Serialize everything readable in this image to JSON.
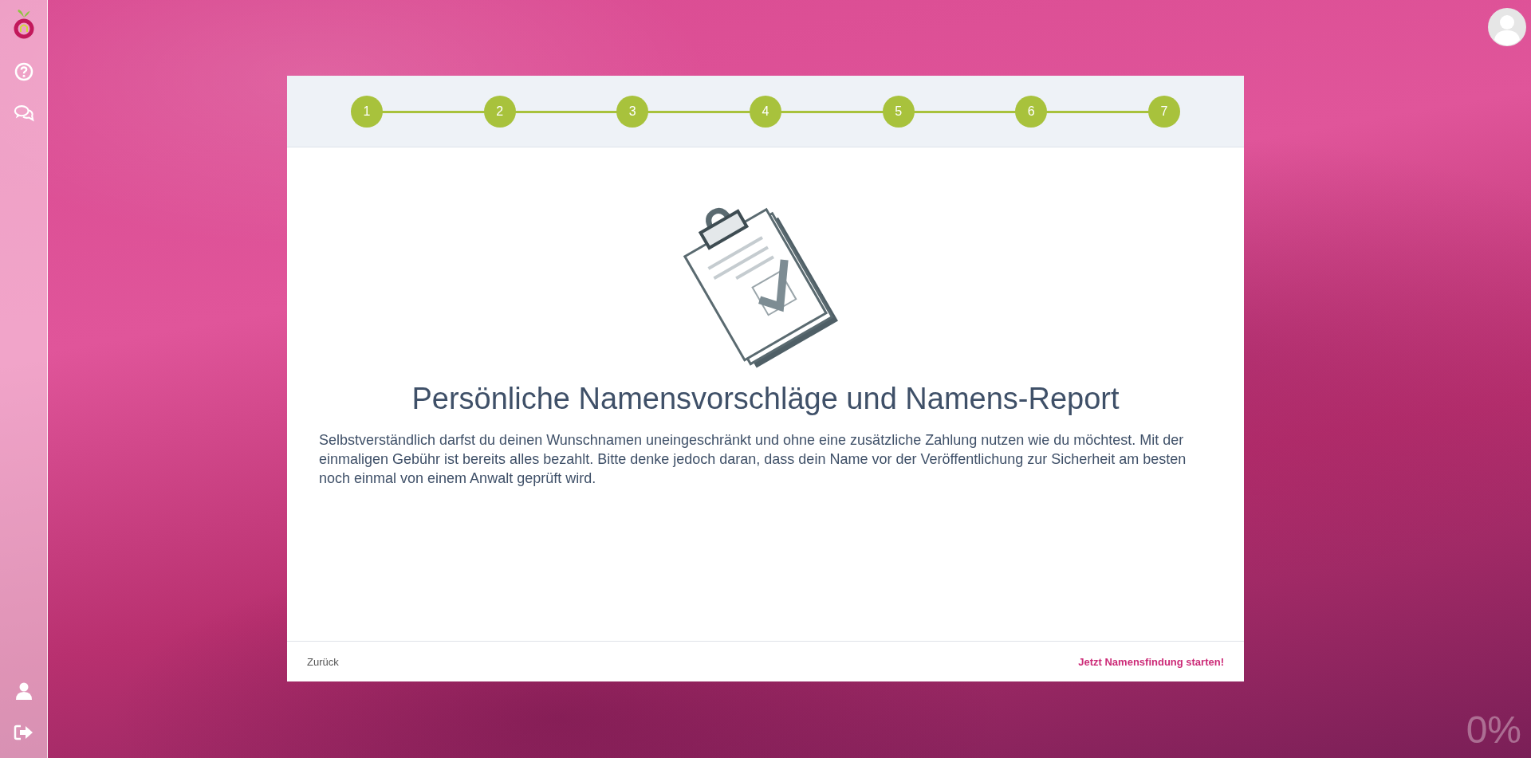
{
  "steps": [
    {
      "label": "1"
    },
    {
      "label": "2"
    },
    {
      "label": "3"
    },
    {
      "label": "4"
    },
    {
      "label": "5"
    },
    {
      "label": "6"
    },
    {
      "label": "7"
    }
  ],
  "card": {
    "title": "Persönliche Namensvorschläge und Namens-Report",
    "text": "Selbstverständlich darfst du deinen Wunschnamen uneingeschränkt und ohne eine zusätzliche Zahlung nutzen wie du möchtest. Mit der einmaligen Gebühr ist bereits alles bezahlt. Bitte denke jedoch daran, dass dein Name vor der Veröffentlichung zur Sicherheit am besten noch einmal von einem Anwalt geprüft wird."
  },
  "footer": {
    "back": "Zurück",
    "next": "Jetzt Namensfindung starten!"
  },
  "progress": {
    "label": "0%"
  }
}
